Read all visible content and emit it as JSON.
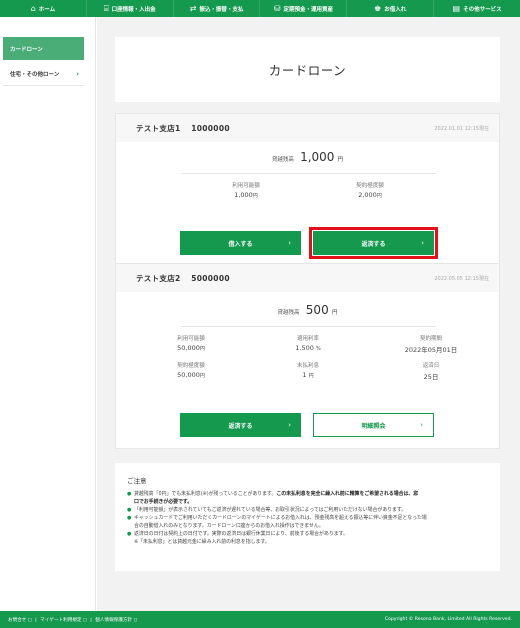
{
  "nav": {
    "items": [
      {
        "icon": "⌂",
        "label": "ホーム"
      },
      {
        "icon": "⌸",
        "label": "口座情報・入出金"
      },
      {
        "icon": "⇄",
        "label": "振込・振替・支払"
      },
      {
        "icon": "⛁",
        "label": "定期預金・運用資産"
      },
      {
        "icon": "♚",
        "label": "お借入れ"
      },
      {
        "icon": "▤",
        "label": "その他サービス"
      }
    ]
  },
  "sidebar": {
    "items": [
      {
        "label": "カードローン"
      },
      {
        "label": "住宅・その他ローン"
      }
    ],
    "chevron": "›"
  },
  "main": {
    "title": "カードローン"
  },
  "card1": {
    "account": "テスト支店1　 1000000",
    "timestamp": "2022.01.01 12:15現在",
    "balance_label": "貸越残高",
    "balance_value": "1,000",
    "balance_unit": "円",
    "available_label": "利用可能額",
    "available_value": "1,000",
    "limit_label": "契約極度額",
    "limit_value": "2,000",
    "unit": "円",
    "borrow_button": "借入する",
    "repay_button": "返済する",
    "arrow": "›"
  },
  "card2": {
    "account": "テスト支店2　 5000000",
    "timestamp": "2022.05.05 12:15現在",
    "balance_label": "貸越残高",
    "balance_value": "500",
    "balance_unit": "円",
    "available_label": "利用可能額",
    "available_value": "50,000",
    "rate_label": "適用利率",
    "rate_value": "1.500",
    "rate_unit": "%",
    "term_label": "契約期間",
    "term_value": "2022年05月01日",
    "limit_label": "契約極度額",
    "limit_value": "50,000",
    "unpaid_label": "未払利息",
    "unpaid_value": "1",
    "repay_day_label": "返済日",
    "repay_day_value": "25日",
    "unit": "円",
    "repay_button": "返済する",
    "details_button": "明細照会",
    "arrow": "›"
  },
  "notes": {
    "title": "ご注意",
    "lines": [
      {
        "bullet": "●",
        "text": "貸越残高「0円」でも未払利息(※)が残っていることがあります。",
        "bold": "この未払利息を完全に繰入れ前に精算をご希望される場合は、窓"
      },
      {
        "bullet": "",
        "text": "",
        "bold": "口でお手続きが必要です。"
      },
      {
        "bullet": "●",
        "text": "「利用可能額」が表示されていてもご返済が遅れている場合等、お取引状況によってはご利用いただけない場合があります。",
        "bold": ""
      },
      {
        "bullet": "●",
        "text": "キャッシュカードでご利用いただくカードローンのマイゲートによるお借入れは、預金残高を超える振込等に伴い資金不足となった場",
        "bold": ""
      },
      {
        "bullet": "",
        "text": "合の自動借入れのみとなります。カードローン口座からのお借入れ操作はできません。",
        "bold": ""
      },
      {
        "bullet": "●",
        "text": "返済日の日付は契約上の日付です。実際の返済日は銀行休業日により、前後する場合があります。",
        "bold": ""
      },
      {
        "bullet": "",
        "text": "※「未払利息」とは貸越元金に繰み入れ前の利息を指します。",
        "bold": ""
      }
    ]
  },
  "footer": {
    "links": [
      "お問合せ ◻",
      "マイゲート利用規定 ◻",
      "個人情報保護方針 ◻"
    ],
    "separator": "|",
    "copyright": "Copyright © Resona Bank, Limited All Rights Reserved."
  },
  "colors": {
    "brand_green": "#14994f",
    "sidebar_active": "#4aad78",
    "highlight_red": "#e0111b"
  }
}
